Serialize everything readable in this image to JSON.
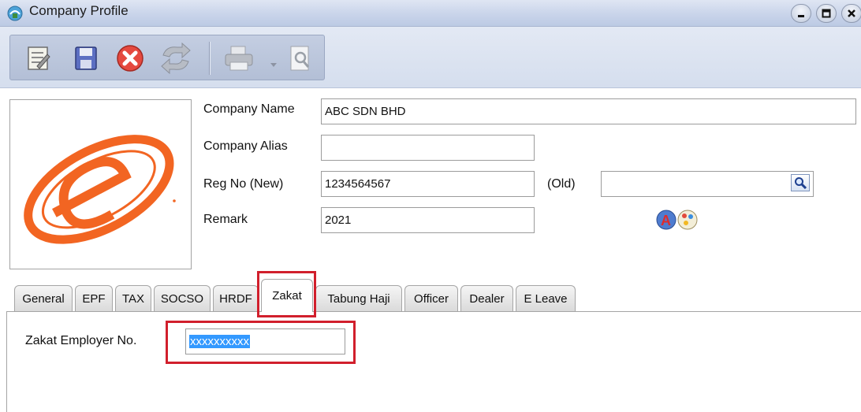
{
  "window": {
    "title": "Company Profile",
    "controls": [
      "minimize",
      "maximize",
      "close"
    ]
  },
  "toolbar": {
    "buttons": [
      {
        "name": "edit",
        "icon": "edit-icon",
        "enabled": true
      },
      {
        "name": "save",
        "icon": "save-icon",
        "enabled": true
      },
      {
        "name": "cancel",
        "icon": "cancel-icon",
        "enabled": true
      },
      {
        "name": "refresh",
        "icon": "refresh-icon",
        "enabled": false
      },
      {
        "name": "print",
        "icon": "printer-icon",
        "enabled": false
      },
      {
        "name": "preview",
        "icon": "print-preview-icon",
        "enabled": false
      }
    ]
  },
  "company": {
    "name_label": "Company Name",
    "name_value": "ABC SDN BHD",
    "alias_label": "Company Alias",
    "alias_value": "",
    "regno_new_label": "Reg No (New)",
    "regno_new_value": "1234564567",
    "regno_old_label": "(Old)",
    "regno_old_value": "",
    "remark_label": "Remark",
    "remark_value": "2021"
  },
  "tabs": [
    {
      "label": "General"
    },
    {
      "label": "EPF"
    },
    {
      "label": "TAX"
    },
    {
      "label": "SOCSO"
    },
    {
      "label": "HRDF"
    },
    {
      "label": "Zakat",
      "active": true
    },
    {
      "label": "Tabung Haji"
    },
    {
      "label": "Officer"
    },
    {
      "label": "Dealer"
    },
    {
      "label": "E Leave"
    }
  ],
  "zakat": {
    "employer_no_label": "Zakat Employer No.",
    "employer_no_value": "xxxxxxxxxx"
  },
  "colors": {
    "highlight_red": "#d11f2c",
    "selection_blue": "#3399ff",
    "logo_orange": "#f26522"
  }
}
